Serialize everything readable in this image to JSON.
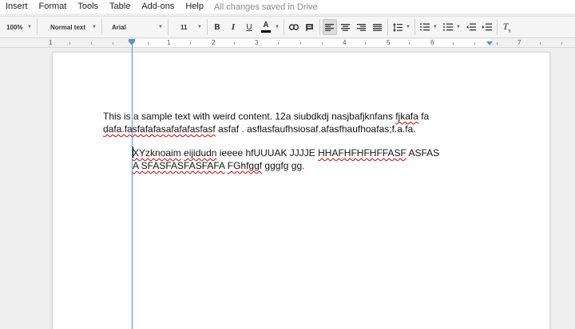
{
  "menu": [
    "Insert",
    "Format",
    "Tools",
    "Table",
    "Add-ons",
    "Help"
  ],
  "save_status": "All changes saved in Drive",
  "toolbar": {
    "zoom": "100%",
    "style": "Normal text",
    "font": "Arial",
    "size": "11",
    "bold": "B",
    "italic": "I",
    "underline": "U",
    "text_color": "A",
    "text_color_bar": "#000000"
  },
  "ruler": {
    "numbers": [
      "1",
      "1",
      "2",
      "3",
      "4",
      "5",
      "6",
      "7"
    ]
  },
  "document": {
    "para1_line1_segments": [
      {
        "text": "This is a sample text with weird content. 12a siubdkdj nasjbafjknfans ",
        "spell": false
      },
      {
        "text": "fjkafa",
        "spell": true
      },
      {
        "text": " fa",
        "spell": false
      }
    ],
    "para1_line2_segments": [
      {
        "text": "dafa.fasfafafasafafafasfasf",
        "spell": true
      },
      {
        "text": " asfaf . asflasfaufhsiosaf.afasfhaufhoafas;f.a.fa.",
        "spell": false
      }
    ],
    "para2_line1_segments": [
      {
        "text": "XYzknoaim",
        "spell": true
      },
      {
        "text": " ",
        "spell": false
      },
      {
        "text": "eijidudn",
        "spell": true
      },
      {
        "text": " ieeee hfUUUAK JJJJE ",
        "spell": false
      },
      {
        "text": "HHAFHFHFHFFASF",
        "spell": true
      },
      {
        "text": " ASFAS",
        "spell": false
      }
    ],
    "para2_line2_segments": [
      {
        "text": "A SFASFASFASFAFA",
        "spell": true
      },
      {
        "text": " ",
        "spell": false
      },
      {
        "text": "FGhfggf",
        "spell": true
      },
      {
        "text": " gggfg  gg.",
        "spell": false
      }
    ]
  }
}
